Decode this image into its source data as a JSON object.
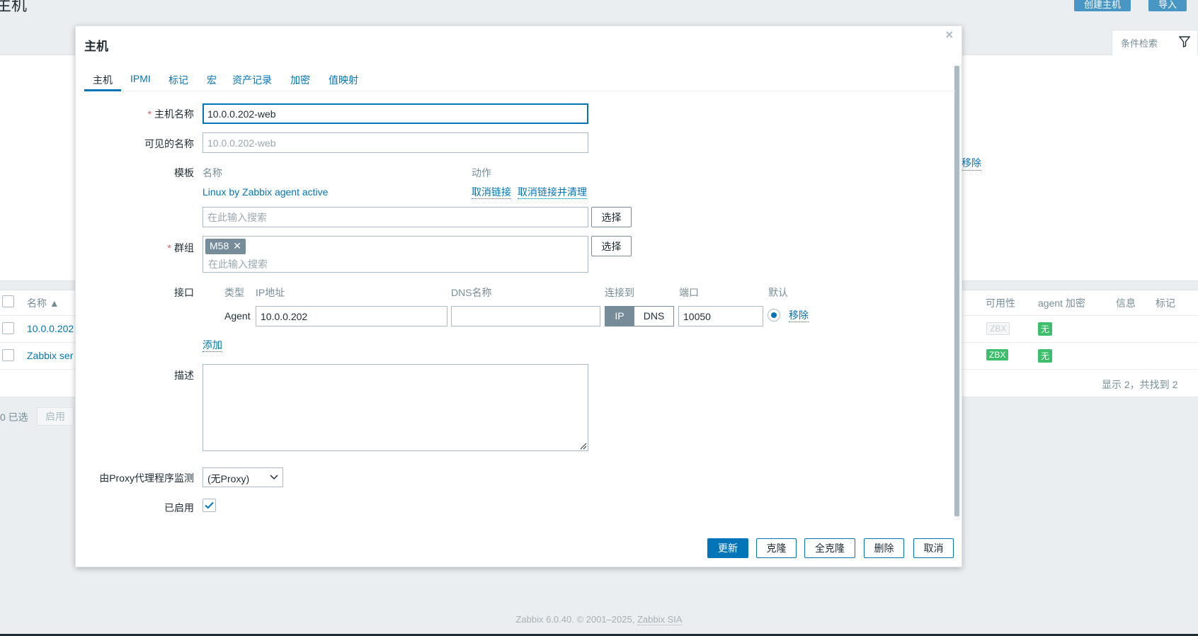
{
  "background": {
    "page_title": "主机",
    "create_host_button": "创建主机",
    "import_button": "导入",
    "filter_tab": "条件检索",
    "filter_remove_link": "移除",
    "table_headers": {
      "name": "名称 ▲",
      "availability": "可用性",
      "agent_encryption": "agent 加密",
      "info": "信息",
      "tags": "标记"
    },
    "rows": [
      {
        "name": "10.0.0.202",
        "availability": "ZBX",
        "encryption": "无"
      },
      {
        "name": "Zabbix ser",
        "availability": "ZBX",
        "encryption": "无"
      }
    ],
    "summary": "显示 2，共找到 2",
    "selected_text": "0 已选",
    "enable_button": "启用",
    "footer_text": "Zabbix 6.0.40. © 2001–2025, ",
    "footer_link": "Zabbix SIA"
  },
  "modal": {
    "title": "主机",
    "close_glyph": "×",
    "tabs": [
      "主机",
      "IPMI",
      "标记",
      "宏",
      "资产记录",
      "加密",
      "值映射"
    ],
    "form": {
      "host_name_label": "主机名称",
      "host_name_value": "10.0.0.202-web",
      "visible_name_label": "可见的名称",
      "visible_name_placeholder": "10.0.0.202-web",
      "templates_label": "模板",
      "templates_name_header": "名称",
      "templates_action_header": "动作",
      "template_name": "Linux by Zabbix agent active",
      "unlink_label": "取消链接",
      "unlink_clear_label": "取消链接并清理",
      "search_placeholder": "在此输入搜索",
      "select_button": "选择",
      "groups_label": "群组",
      "group_chip": "M58",
      "group_chip_remove": "✕",
      "interfaces_label": "接口",
      "iface_headers": {
        "type": "类型",
        "ip": "IP地址",
        "dns": "DNS名称",
        "connect_to": "连接到",
        "port": "端口",
        "default": "默认"
      },
      "iface_type": "Agent",
      "iface_ip": "10.0.0.202",
      "iface_dns": "",
      "connect_ip": "IP",
      "connect_dns": "DNS",
      "iface_port": "10050",
      "iface_remove": "移除",
      "add_link": "添加",
      "description_label": "描述",
      "description_value": "",
      "proxy_label": "由Proxy代理程序监测",
      "proxy_value": "(无Proxy)",
      "enabled_label": "已启用",
      "enabled": true
    },
    "buttons": {
      "update": "更新",
      "clone": "克隆",
      "full_clone": "全克隆",
      "delete": "删除",
      "cancel": "取消"
    }
  }
}
